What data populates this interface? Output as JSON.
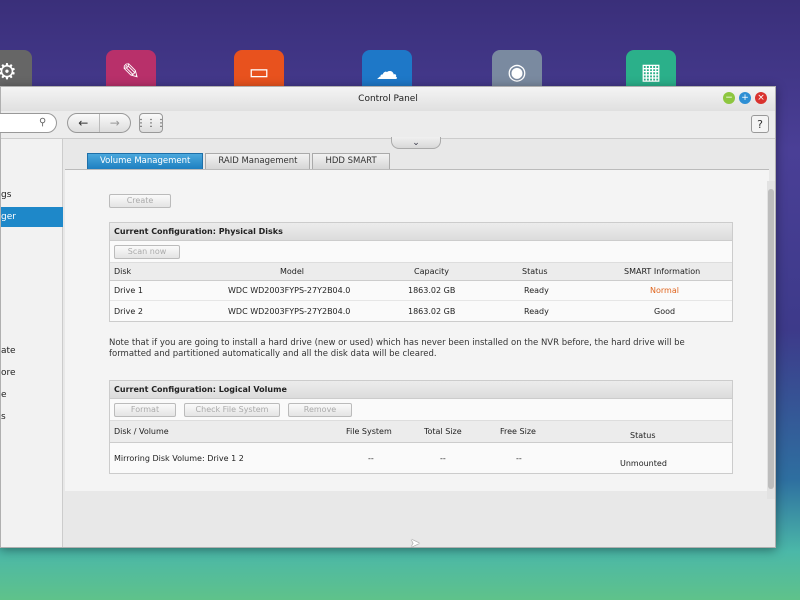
{
  "window": {
    "title": "Control Panel"
  },
  "colors": {
    "accent": "#1e88c9",
    "warning": "#e0651e",
    "minimize": "#8dc63f",
    "maximize": "#2e8fd4",
    "close": "#d9322e"
  },
  "desktop_icons": [
    {
      "name": "settings-app-icon",
      "color": "#555"
    },
    {
      "name": "tools-app-icon",
      "color": "#b8306a"
    },
    {
      "name": "folder-app-icon",
      "color": "#e8521e"
    },
    {
      "name": "cloud-app-icon",
      "color": "#1e78c8"
    },
    {
      "name": "storage-app-icon",
      "color": "#7a8aa0"
    },
    {
      "name": "grid-app-icon",
      "color": "#2bb08a"
    }
  ],
  "toolbar": {
    "back": "←",
    "forward": "→",
    "apps": "⋮⋮⋮",
    "help": "?",
    "search_icon": "⚲"
  },
  "sidebar": {
    "items": [
      {
        "label": "gs",
        "active": false
      },
      {
        "label": "ger",
        "active": true
      },
      {
        "label": "ate",
        "active": false
      },
      {
        "label": "ore",
        "active": false
      },
      {
        "label": "e",
        "active": false
      },
      {
        "label": "s",
        "active": false
      }
    ]
  },
  "tabs": [
    {
      "label": "Volume Management",
      "active": true
    },
    {
      "label": "RAID Management",
      "active": false
    },
    {
      "label": "HDD SMART",
      "active": false
    }
  ],
  "create_button": "Create",
  "physical": {
    "title": "Current Configuration: Physical Disks",
    "scan_button": "Scan now",
    "columns": [
      "Disk",
      "Model",
      "Capacity",
      "Status",
      "SMART Information"
    ],
    "rows": [
      {
        "disk": "Drive 1",
        "model": "WDC WD2003FYPS-27Y2B04.0",
        "capacity": "1863.02 GB",
        "status": "Ready",
        "smart": "Normal"
      },
      {
        "disk": "Drive 2",
        "model": "WDC WD2003FYPS-27Y2B04.0",
        "capacity": "1863.02 GB",
        "status": "Ready",
        "smart": "Good"
      }
    ]
  },
  "note": "Note that if you are going to install a hard drive (new or used) which has never been installed on the NVR before, the hard drive will be formatted and partitioned automatically and all the disk data will be cleared.",
  "logical": {
    "title": "Current Configuration: Logical Volume",
    "buttons": {
      "format": "Format",
      "check": "Check File System",
      "remove": "Remove"
    },
    "columns": [
      "Disk / Volume",
      "File System",
      "Total Size",
      "Free Size",
      "Status"
    ],
    "rows": [
      {
        "volume": "Mirroring Disk Volume: Drive 1 2",
        "fs": "--",
        "total": "--",
        "free": "--",
        "status": "Unmounted"
      }
    ]
  }
}
